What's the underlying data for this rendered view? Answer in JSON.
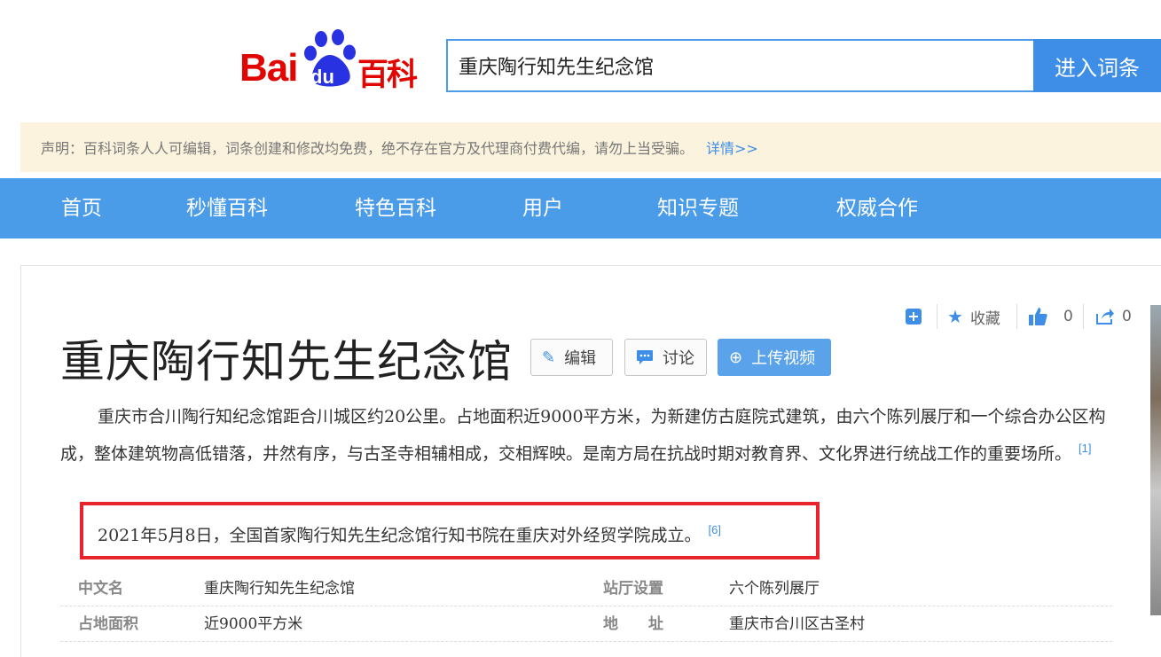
{
  "header": {
    "logo": {
      "bai": "Bai",
      "du": "du",
      "baike": "百科"
    },
    "search": {
      "value": "重庆陶行知先生纪念馆"
    },
    "search_button": "进入词条"
  },
  "notice": {
    "text": "声明：百科词条人人可编辑，词条创建和修改均免费，绝不存在官方及代理商付费代编，请勿上当受骗。",
    "link": "详情>>"
  },
  "nav": {
    "items": [
      {
        "label": "首页"
      },
      {
        "label": "秒懂百科"
      },
      {
        "label": "特色百科"
      },
      {
        "label": "用户"
      },
      {
        "label": "知识专题"
      },
      {
        "label": "权威合作"
      }
    ]
  },
  "toolbar": {
    "favorite_label": "收藏",
    "like_count": "0",
    "share_count": "0"
  },
  "article": {
    "title": "重庆陶行知先生纪念馆",
    "buttons": {
      "edit": "编辑",
      "discuss": "讨论",
      "upload_video": "上传视频"
    },
    "summary": "重庆市合川陶行知纪念馆距合川城区约20公里。占地面积近9000平方米，为新建仿古庭院式建筑，由六个陈列展厅和一个综合办公区构成，整体建筑物高低错落，井然有序，与古圣寺相辅相成，交相辉映。是南方局在抗战时期对教育界、文化界进行统战工作的重要场所。",
    "summary_ref": "[1]",
    "highlight": "2021年5月8日，全国首家陶行知先生纪念馆行知书院在重庆对外经贸学院成立。",
    "highlight_ref": "[6]"
  },
  "infobox": {
    "rows": [
      {
        "label1": "中文名",
        "value1": "重庆陶行知先生纪念馆",
        "label2": "站厅设置",
        "value2": "六个陈列展厅"
      },
      {
        "label1": "占地面积",
        "value1": "近9000平方米",
        "label2": "地　　址",
        "value2": "重庆市合川区古圣村"
      }
    ]
  },
  "colors": {
    "brand_red": "#e10601",
    "accent_blue": "#3e8ee8",
    "nav_blue": "#4a9be8",
    "notice_bg": "#fbf3dd",
    "highlight_border": "#e8232b"
  }
}
